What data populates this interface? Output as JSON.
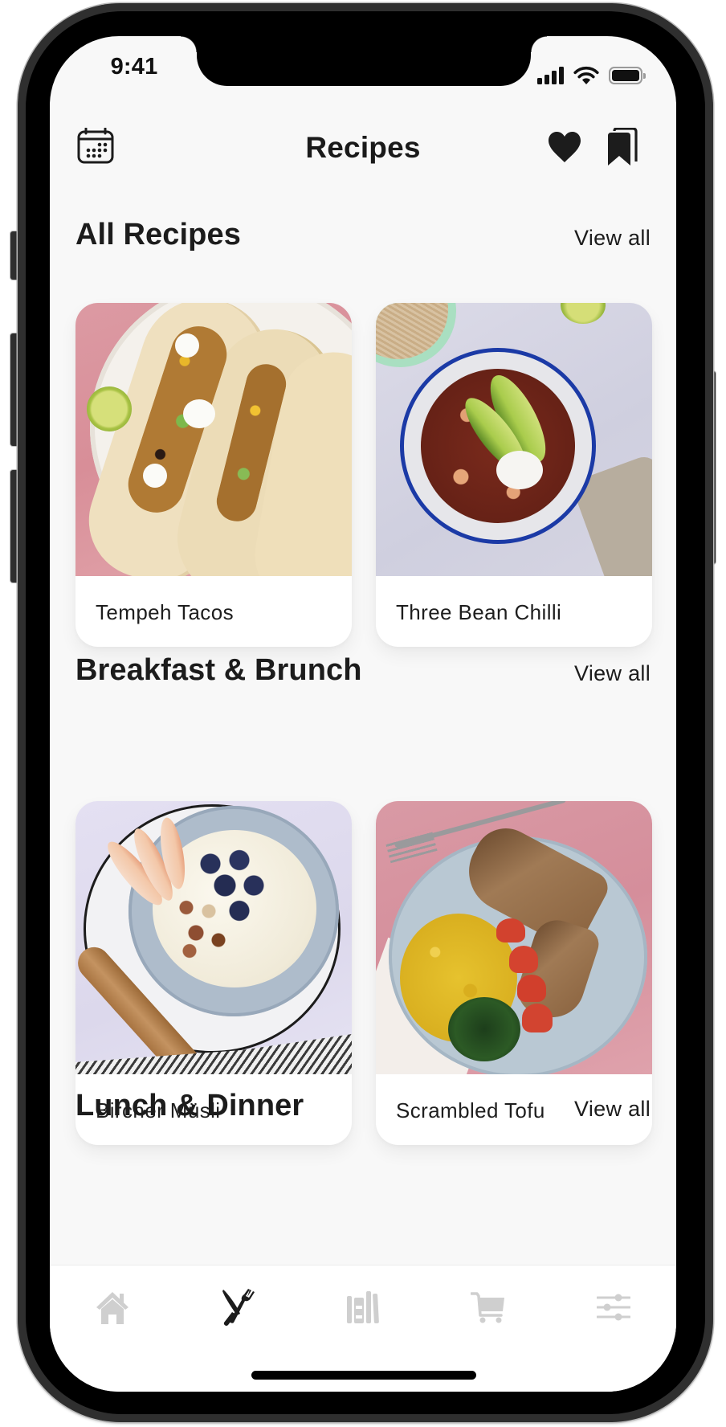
{
  "status_bar": {
    "time": "9:41",
    "icons": [
      "cellular-signal-icon",
      "wifi-icon",
      "battery-icon"
    ]
  },
  "header": {
    "title": "Recipes",
    "left_icon": "calendar-icon",
    "right_icons": [
      "heart-icon",
      "bookmarks-icon"
    ]
  },
  "sections": [
    {
      "title": "All Recipes",
      "view_all_label": "View all",
      "recipes": [
        {
          "name": "Tempeh Tacos",
          "image": "tempeh-tacos-photo"
        },
        {
          "name": "Three Bean Chilli",
          "image": "three-bean-chilli-photo"
        }
      ]
    },
    {
      "title": "Breakfast & Brunch",
      "view_all_label": "View all",
      "recipes": [
        {
          "name": "Bircher Müsli",
          "image": "bircher-musli-photo"
        },
        {
          "name": "Scrambled Tofu",
          "image": "scrambled-tofu-photo"
        }
      ]
    },
    {
      "title": "Lunch & Dinner",
      "view_all_label": "View all",
      "recipes": []
    }
  ],
  "tab_bar": {
    "active_index": 1,
    "active_color": "#1c1c1c",
    "inactive_color": "#cfcfcf",
    "tabs": [
      {
        "icon": "home-icon"
      },
      {
        "icon": "fork-knife-icon"
      },
      {
        "icon": "library-icon"
      },
      {
        "icon": "cart-icon"
      },
      {
        "icon": "sliders-icon"
      }
    ]
  }
}
